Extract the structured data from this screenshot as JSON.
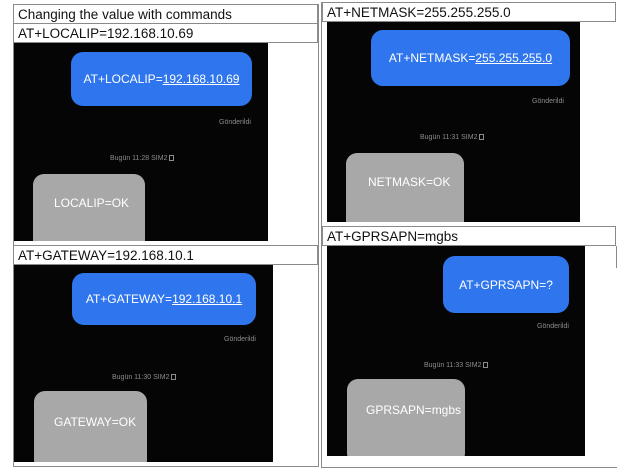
{
  "left_column": {
    "title": "Changing the value with commands",
    "localip": {
      "header": "AT+LOCALIP=192.168.10.69",
      "outgoing_prefix": "AT+LOCALIP=",
      "outgoing_value": "192.168.10.69",
      "sent_label": "Gönderildi",
      "timestamp": "Bugün 11:28 SIM2",
      "reply": "LOCALIP=OK"
    },
    "gateway": {
      "header": "AT+GATEWAY=192.168.10.1",
      "outgoing_prefix": "AT+GATEWAY=",
      "outgoing_value": "192.168.10.1",
      "sent_label": "Gönderildi",
      "timestamp": "Bugün 11:30 SIM2",
      "reply": "GATEWAY=OK"
    }
  },
  "right_column": {
    "netmask": {
      "header": "AT+NETMASK=255.255.255.0",
      "outgoing_prefix": "AT+NETMASK=",
      "outgoing_value": "255.255.255.0",
      "sent_label": "Gönderildi",
      "timestamp": "Bugün 11:31 SIM2",
      "reply": "NETMASK=OK"
    },
    "gprsapn": {
      "header": "AT+GPRSAPN=mgbs",
      "outgoing_text": "AT+GPRSAPN=?",
      "sent_label": "Gönderildi",
      "timestamp": "Bugün 11:33 SIM2",
      "reply": "GPRSAPN=mgbs"
    }
  },
  "colors": {
    "outgoing_bubble": "#2f76ee",
    "incoming_bubble": "#a8a8a8",
    "screen_background": "#050505"
  }
}
